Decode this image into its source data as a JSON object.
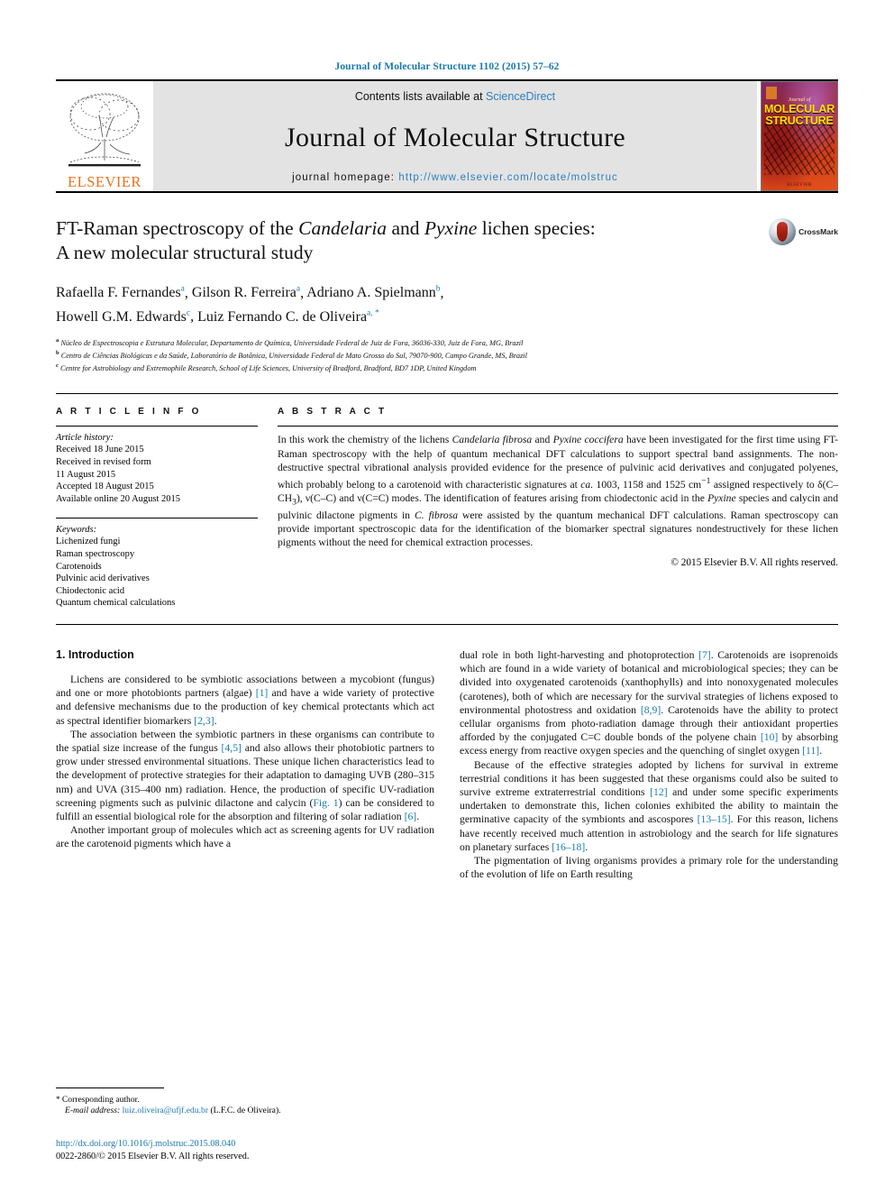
{
  "running_head": "Journal of Molecular Structure 1102 (2015) 57–62",
  "masthead": {
    "contents_prefix": "Contents lists available at ",
    "sciencedirect": "ScienceDirect",
    "journal_name": "Journal of Molecular Structure",
    "homepage_prefix": "journal homepage: ",
    "homepage_url": "http://www.elsevier.com/locate/molstruc",
    "publisher_wordmark": "ELSEVIER",
    "cover": {
      "sub": "Journal of",
      "title_line1": "MOLECULAR",
      "title_line2": "STRUCTURE",
      "footer": "ELSEVIER"
    }
  },
  "article": {
    "title_line1_a": "FT-Raman spectroscopy of the ",
    "title_line1_it1": "Candelaria",
    "title_line1_b": " and ",
    "title_line1_it2": "Pyxine",
    "title_line1_c": " lichen species:",
    "title_line2": "A new molecular structural study",
    "crossmark_label": "CrossMark",
    "authors": [
      {
        "name": "Rafaella F. Fernandes",
        "sup": "a",
        "sep": ", "
      },
      {
        "name": "Gilson R. Ferreira",
        "sup": "a",
        "sep": ", "
      },
      {
        "name": "Adriano A. Spielmann",
        "sup": "b",
        "sep": ","
      },
      {
        "name": "Howell G.M. Edwards",
        "sup": "c",
        "sep": ", "
      },
      {
        "name": "Luiz Fernando C. de Oliveira",
        "sup": "a, *",
        "sep": ""
      }
    ],
    "affiliations": [
      {
        "mark": "a",
        "text": "Núcleo de Espectroscopia e Estrutura Molecular, Departamento de Química, Universidade Federal de Juiz de Fora, 36036-330, Juiz de Fora, MG, Brazil"
      },
      {
        "mark": "b",
        "text": "Centro de Ciências Biológicas e da Saúde, Laboratório de Botânica, Universidade Federal de Mato Grosso do Sul, 79070-900, Campo Grande, MS, Brazil"
      },
      {
        "mark": "c",
        "text": "Centre for Astrobiology and Extremophile Research, School of Life Sciences, University of Bradford, Bradford, BD7 1DP, United Kingdom"
      }
    ]
  },
  "article_info": {
    "heading": "A R T I C L E   I N F O",
    "history_label": "Article history:",
    "history": [
      "Received 18 June 2015",
      "Received in revised form",
      "11 August 2015",
      "Accepted 18 August 2015",
      "Available online 20 August 2015"
    ],
    "keywords_label": "Keywords:",
    "keywords": [
      "Lichenized fungi",
      "Raman spectroscopy",
      "Carotenoids",
      "Pulvinic acid derivatives",
      "Chiodectonic acid",
      "Quantum chemical calculations"
    ]
  },
  "abstract": {
    "heading": "A B S T R A C T",
    "p1_a": "In this work the chemistry of the lichens ",
    "p1_it1": "Candelaria fibrosa",
    "p1_b": " and ",
    "p1_it2": "Pyxine cocciferа",
    "p1_c": " have been investigated for the first time using FT-Raman spectroscopy with the help of quantum mechanical DFT calculations to support spectral band assignments. The non-destructive spectral vibrational analysis provided evidence for the presence of pulvinic acid derivatives and conjugated polyenes, which probably belong to a carotenoid with characteristic signatures at ",
    "p1_ca": "ca.",
    "p1_d": " 1003, 1158 and 1525 cm",
    "p1_sup": "−1",
    "p1_e": " assigned respectively to δ(C",
    "p1_f": "–CH",
    "p1_sub1": "3",
    "p1_g": "), ν(C–C) and ν(C=C) modes. The identification of features arising from chiodectonic acid in the ",
    "p1_it3": "Pyxine",
    "p1_h": " species and calycin and pulvinic dilactone pigments in ",
    "p1_it4": "C. fibrosa",
    "p1_i": " were assisted by the quantum mechanical DFT calculations. Raman spectroscopy can provide important spectroscopic data for the identification of the biomarker spectral signatures nondestructively for these lichen pigments without the need for chemical extraction processes.",
    "copyright": "© 2015 Elsevier B.V. All rights reserved."
  },
  "intro": {
    "heading": "1.  Introduction",
    "left": {
      "p1_a": "Lichens are considered to be symbiotic associations between a mycobiont (fungus) and one or more photobionts partners (algae) ",
      "p1_r1": "[1]",
      "p1_b": " and have a wide variety of protective and defensive mechanisms due to the production of key chemical protectants which act as spectral identifier biomarkers ",
      "p1_r2": "[2,3]",
      "p1_c": ".",
      "p2_a": "The association between the symbiotic partners in these organisms can contribute to the spatial size increase of the fungus ",
      "p2_r1": "[4,5]",
      "p2_b": " and also allows their photobiotic partners to grow under stressed environmental situations. These unique lichen characteristics lead to the development of protective strategies for their adaptation to damaging UVB (280–315 nm) and UVA (315–400 nm) radiation. Hence, the production of specific UV-radiation screening pigments such as pulvinic dilactone and calycin (",
      "p2_fig": "Fig. 1",
      "p2_c": ") can be considered to fulfill an essential biological role for the absorption and filtering of solar radiation ",
      "p2_r2": "[6]",
      "p2_d": ".",
      "p3": "Another important group of molecules which act as screening agents for UV radiation are the carotenoid pigments which have a"
    },
    "right": {
      "p1_a": "dual role in both light-harvesting and photoprotection ",
      "p1_r1": "[7]",
      "p1_b": ". Carotenoids are isoprenoids which are found in a wide variety of botanical and microbiological species; they can be divided into oxygenated carotenoids (xanthophylls) and into nonoxygenated molecules (carotenes), both of which are necessary for the survival strategies of lichens exposed to environmental photostress and oxidation ",
      "p1_r2": "[8,9]",
      "p1_c": ". Carotenoids have the ability to protect cellular organisms from photo-radiation damage through their antioxidant properties afforded by the conjugated C=C double bonds of the polyene chain ",
      "p1_r3": "[10]",
      "p1_d": " by absorbing excess energy from reactive oxygen species and the quenching of singlet oxygen ",
      "p1_r4": "[11]",
      "p1_e": ".",
      "p2_a": "Because of the effective strategies adopted by lichens for survival in extreme terrestrial conditions it has been suggested that these organisms could also be suited to survive extreme extraterrestrial conditions ",
      "p2_r1": "[12]",
      "p2_b": " and under some specific experiments undertaken to demonstrate this, lichen colonies exhibited the ability to maintain the germinative capacity of the symbionts and ascospores ",
      "p2_r2": "[13–15]",
      "p2_c": ". For this reason, lichens have recently received much attention in astrobiology and the search for life signatures on planetary surfaces ",
      "p2_r3": "[16–18]",
      "p2_d": ".",
      "p3": "The pigmentation of living organisms provides a primary role for the understanding of the evolution of life on Earth resulting"
    }
  },
  "footer": {
    "corresponding_star": "*",
    "corresponding_label": "Corresponding author.",
    "email_label": "E-mail address:",
    "email": "luiz.oliveira@ufjf.edu.br",
    "email_owner": "(L.F.C. de Oliveira).",
    "doi": "http://dx.doi.org/10.1016/j.molstruc.2015.08.040",
    "issn_line": "0022-2860/© 2015 Elsevier B.V. All rights reserved."
  },
  "colors": {
    "link": "#1a7aad",
    "elsevier_orange": "#e9711c",
    "band_gray": "#e3e3e3"
  }
}
